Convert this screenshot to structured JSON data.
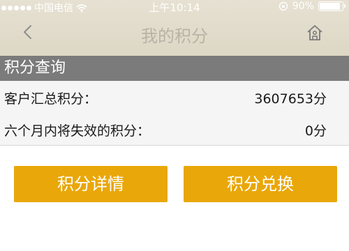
{
  "status_bar": {
    "carrier": "中国电信",
    "time": "上午10:14",
    "battery_percent": "90%",
    "battery_level": 0.9
  },
  "nav": {
    "title": "我的积分",
    "back_icon": "chevron-left-icon",
    "home_icon": "home-icon"
  },
  "section": {
    "header": "积分查询"
  },
  "points": {
    "total_label": "客户汇总积分：",
    "total_value": "3607653分",
    "expiring_label": "六个月内将失效的积分：",
    "expiring_value": "0分"
  },
  "buttons": {
    "detail_label": "积分详情",
    "exchange_label": "积分兑换"
  },
  "colors": {
    "button": "#e9a709",
    "section_header": "#7b7b7b",
    "nav_background": "#e2ddcd"
  }
}
